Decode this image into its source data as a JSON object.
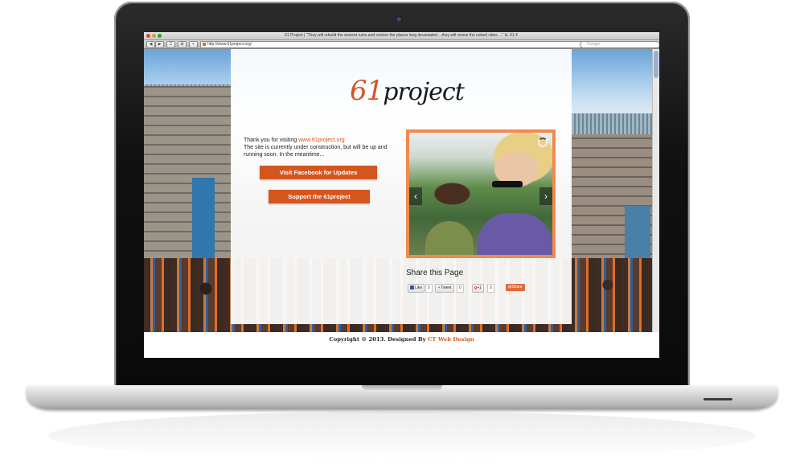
{
  "browser": {
    "window_title": "61 Project | \"They will rebuild the ancient ruins and restore the places long devastated ...they will renew the ruined cities ...\" Is. 61:4",
    "url": "http://www.61project.org/",
    "search_placeholder": "Google",
    "nav_buttons": [
      "◀",
      "▶",
      "C",
      "⊠",
      "+"
    ]
  },
  "logo": {
    "number": "61",
    "word": "project"
  },
  "intro": {
    "thanks_prefix": "Thank you for visiting ",
    "site_link": "www.61project.org",
    "body": "The site is currently under construction, but will be up and running soon.  In the meantime..."
  },
  "buttons": {
    "facebook": "Visit Facebook for Updates",
    "support": "Support the 61project"
  },
  "slider": {
    "prev": "‹",
    "next": "›"
  },
  "share": {
    "title": "Share this Page",
    "like_label": "Like",
    "like_count": "0",
    "tweet_label": "Tweet",
    "tweet_count": "0",
    "plusone_label": "+1",
    "plusone_count": "0",
    "share_label": "Share"
  },
  "footer": {
    "prefix": "Copyright © 2013.  Designed By ",
    "designer": "CT Web Design"
  },
  "colors": {
    "accent": "#d4561f",
    "slider_frame": "#f08b4e"
  }
}
